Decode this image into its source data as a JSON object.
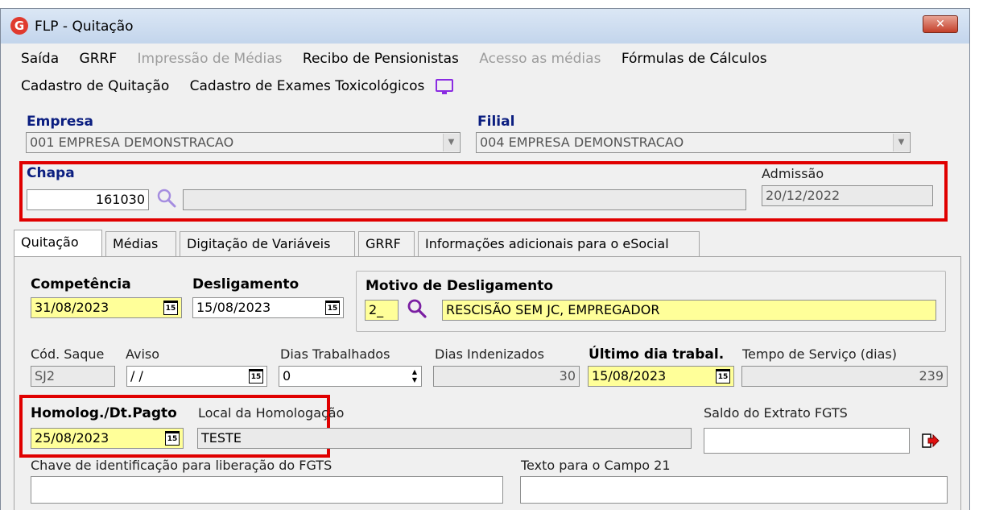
{
  "window": {
    "title": "FLP - Quitação",
    "close_label": "✕"
  },
  "menu": {
    "row1": [
      {
        "label": "Saída",
        "enabled": true
      },
      {
        "label": "GRRF",
        "enabled": true
      },
      {
        "label": "Impressão de Médias",
        "enabled": false
      },
      {
        "label": "Recibo de Pensionistas",
        "enabled": true
      },
      {
        "label": "Acesso as médias",
        "enabled": false
      },
      {
        "label": "Fórmulas de Cálculos",
        "enabled": true
      }
    ],
    "row2": [
      {
        "label": "Cadastro de Quitação",
        "enabled": true
      },
      {
        "label": "Cadastro de Exames Toxicológicos",
        "enabled": true
      }
    ]
  },
  "empresa": {
    "label": "Empresa",
    "value": "001 EMPRESA DEMONSTRACAO"
  },
  "filial": {
    "label": "Filial",
    "value": "004 EMPRESA DEMONSTRACAO"
  },
  "chapa": {
    "label": "Chapa",
    "value": "161030",
    "name": ""
  },
  "admissao": {
    "label": "Admissão",
    "value": "20/12/2022"
  },
  "tabs": [
    {
      "label": "Quitação"
    },
    {
      "label": "Médias"
    },
    {
      "label": "Digitação de Variáveis"
    },
    {
      "label": "GRRF"
    },
    {
      "label": "Informações adicionais para o eSocial"
    }
  ],
  "competencia": {
    "label": "Competência",
    "value": "31/08/2023"
  },
  "desligamento": {
    "label": "Desligamento",
    "value": "15/08/2023"
  },
  "motivo": {
    "label": "Motivo de Desligamento",
    "code": "2_",
    "desc": "RESCISÃO SEM JC, EMPREGADOR"
  },
  "cod_saque": {
    "label": "Cód. Saque",
    "value": "SJ2"
  },
  "aviso": {
    "label": "Aviso",
    "value": " / /"
  },
  "dias_trabalhados": {
    "label": "Dias Trabalhados",
    "value": "0"
  },
  "dias_indenizados": {
    "label": "Dias Indenizados",
    "value": "30"
  },
  "ultimo_dia": {
    "label": "Último dia trabal.",
    "value": "15/08/2023"
  },
  "tempo_servico": {
    "label": "Tempo de Serviço (dias)",
    "value": "239"
  },
  "homolog": {
    "label": "Homolog./Dt.Pagto",
    "value": "25/08/2023"
  },
  "local_homolog": {
    "label": "Local da Homologação",
    "value": "TESTE"
  },
  "saldo_fgts": {
    "label": "Saldo do Extrato FGTS",
    "value": ""
  },
  "chave_fgts": {
    "label": "Chave de identificação para liberação do FGTS",
    "value": ""
  },
  "campo21": {
    "label": "Texto para o Campo 21",
    "value": ""
  },
  "calendar_glyph": "15",
  "colors": {
    "highlight": "#e00000",
    "required_bg": "#ffff99",
    "label_blue": "#0b1e80",
    "search_icon": "#8a2be2"
  }
}
